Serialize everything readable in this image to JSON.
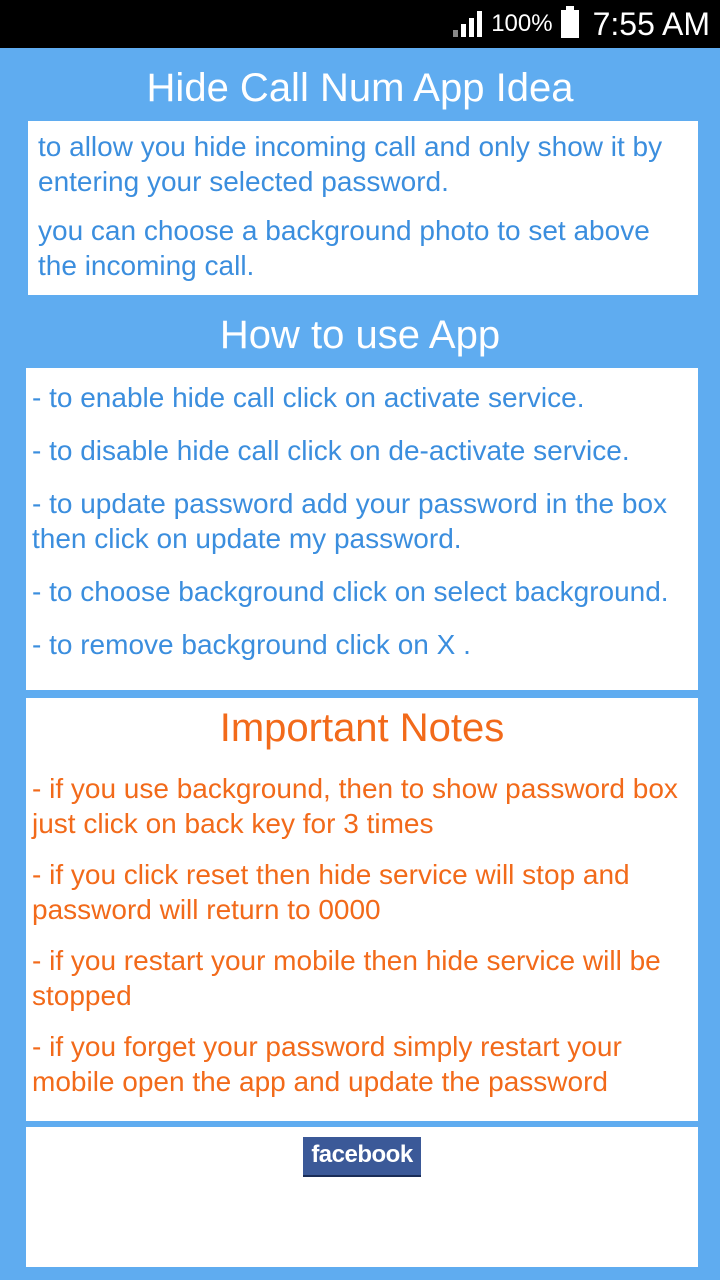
{
  "status": {
    "battery_pct": "100%",
    "time": "7:55 AM"
  },
  "section1": {
    "title": "Hide Call Num App Idea",
    "p1": "to allow you hide incoming call and only show it by entering your selected password.",
    "p2": "you can choose a background photo to set above the incoming call."
  },
  "section2": {
    "title": "How to use App",
    "p1": "- to enable hide call click on activate service.",
    "p2": "- to disable hide call click on de-activate service.",
    "p3": "- to update password add your password in the box then click on update my password.",
    "p4": "- to choose background click on select background.",
    "p5": "- to remove background click on X ."
  },
  "section3": {
    "title": "Important Notes",
    "p1": "- if you use background, then to show password box just click on back key for 3 times",
    "p2": "- if you click reset then hide service will stop and password will return to 0000",
    "p3": "- if you restart your mobile then hide service will be stopped",
    "p4": "- if you forget your password simply restart your mobile open the app and update the password"
  },
  "section4": {
    "fb_label": "facebook"
  }
}
